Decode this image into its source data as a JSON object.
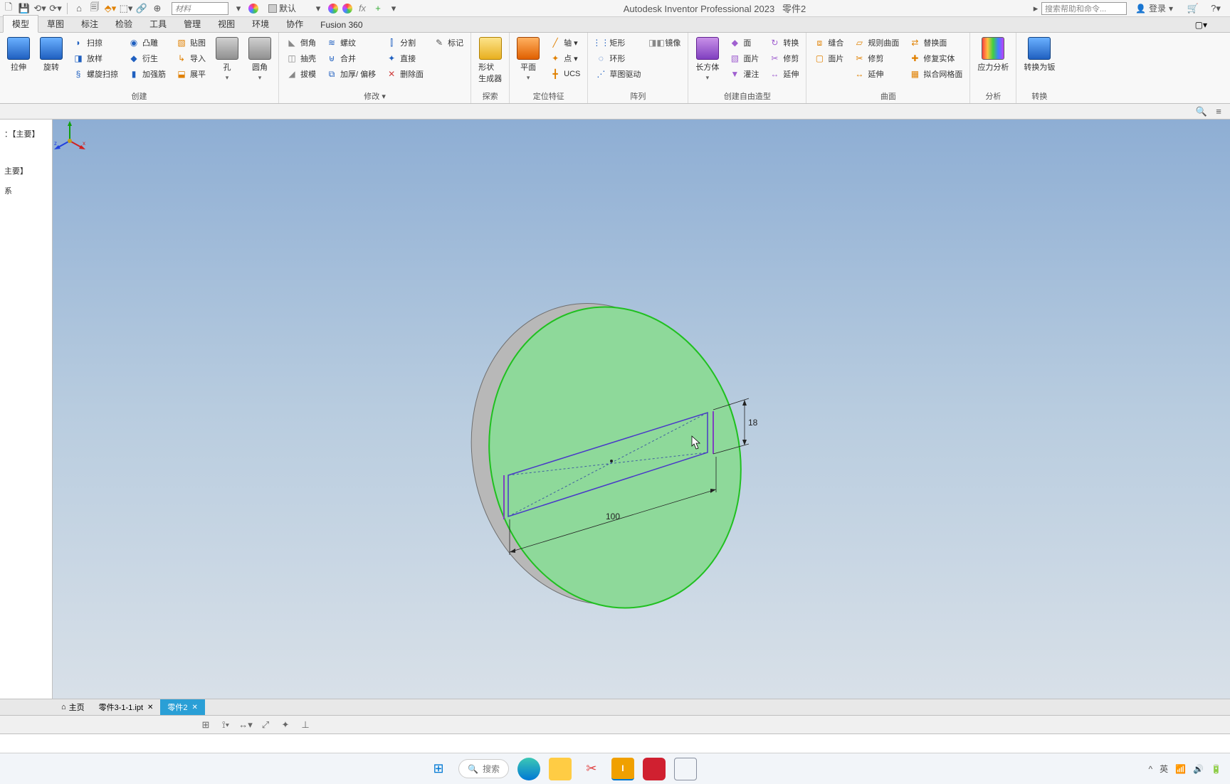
{
  "qat": {
    "material_placeholder": "材料",
    "appearance": "默认"
  },
  "title": {
    "app": "Autodesk Inventor Professional 2023",
    "doc": "零件2"
  },
  "search_placeholder": "搜索帮助和命令...",
  "login": "登录",
  "tabs": [
    "模型",
    "草图",
    "标注",
    "检验",
    "工具",
    "管理",
    "视图",
    "环境",
    "协作",
    "Fusion 360"
  ],
  "ribbon": {
    "create": {
      "label": "创建",
      "extrude": "拉伸",
      "revolve": "旋转",
      "sweep": "扫掠",
      "loft": "放样",
      "coil": "螺旋扫掠",
      "emboss": "凸雕",
      "derive": "衍生",
      "import": "导入",
      "rib": "加强筋",
      "unfold": "展平",
      "decal": "贴图",
      "hole": "孔",
      "fillet": "圆角"
    },
    "modify": {
      "label": "修改 ▾",
      "chamfer": "倒角",
      "thread": "螺纹",
      "shell": "抽壳",
      "combine": "合并",
      "draft": "拔模",
      "thicken": "加厚/ 偏移",
      "split": "分割",
      "direct": "直接",
      "delete": "删除面",
      "mark": "标记"
    },
    "explore": {
      "label": "探索",
      "shapegen": "形状\n生成器"
    },
    "workfeat": {
      "label": "定位特征",
      "plane": "平面",
      "axis": "轴 ▾",
      "point": "点 ▾",
      "ucs": "UCS"
    },
    "pattern": {
      "label": "阵列",
      "rect": "矩形",
      "circ": "环形",
      "sketch": "草图驱动",
      "mirror": "镜像"
    },
    "freeform": {
      "label": "创建自由造型",
      "box": "长方体",
      "face": "面",
      "patch": "面片",
      "sculpt": "灌注",
      "convert": "转换",
      "trim": "修剪",
      "extend": "延伸"
    },
    "surface": {
      "label": "曲面",
      "sew": "缝合",
      "ruled": "规则曲面",
      "replace": "替换面",
      "repair": "修复实体",
      "fitmesh": "拟合网格面"
    },
    "analysis": {
      "label": "分析",
      "stress": "应力分析"
    },
    "convert": {
      "label": "转换",
      "convert": "转换为钣"
    }
  },
  "tree": {
    "main": "：【主要】",
    "node1": "主要】",
    "node2": "系"
  },
  "dims": {
    "width": "100",
    "height": "18"
  },
  "doctabs": {
    "home": "主页",
    "file1": "零件3-1-1.ipt",
    "file2": "零件2"
  },
  "taskbar": {
    "search": "搜索",
    "ime": "英"
  }
}
